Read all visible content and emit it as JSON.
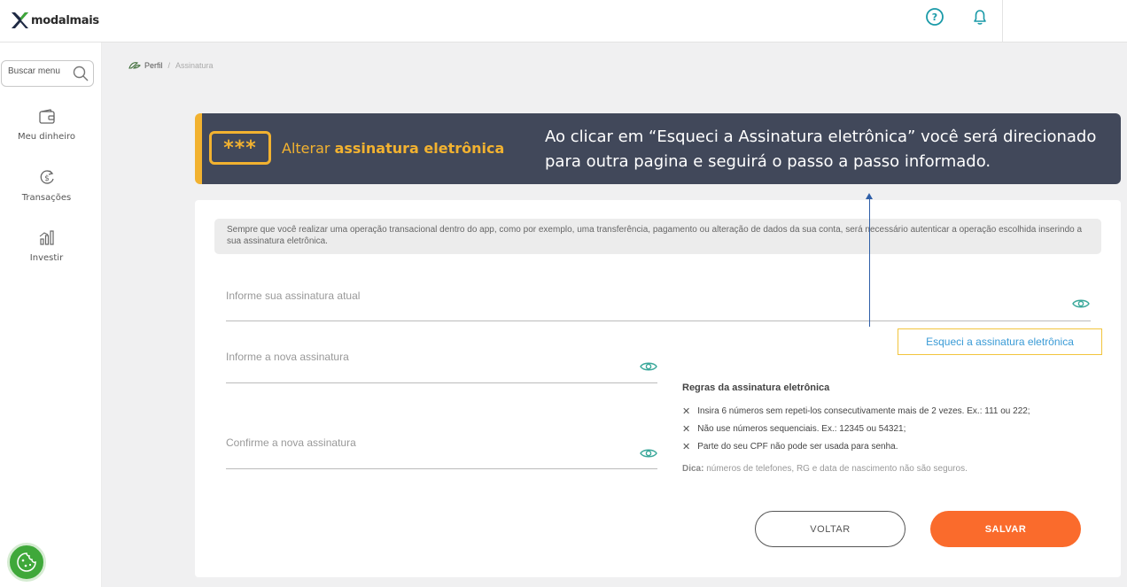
{
  "brand": {
    "name": "modalmais"
  },
  "topbar": {
    "help_icon": "help-circle-icon",
    "bell_icon": "bell-icon"
  },
  "sidebar": {
    "search_placeholder": "Buscar menu",
    "items": [
      {
        "label": "Meu dinheiro",
        "icon": "wallet-icon"
      },
      {
        "label": "Transações",
        "icon": "dollar-transfer-icon"
      },
      {
        "label": "Investir",
        "icon": "bar-chart-icon"
      }
    ]
  },
  "breadcrumb": {
    "root": "Perfil",
    "separator": "/",
    "current": "Assinatura"
  },
  "header": {
    "stars": "***",
    "title_prefix": "Alterar ",
    "title_bold": "assinatura eletrônica",
    "callout": "Ao clicar em “Esqueci a Assinatura eletrônica” você será direcionado para outra pagina e seguirá o passo a passo informado."
  },
  "info_text": "Sempre que você realizar uma operação transacional dentro do app, como por exemplo, uma transferência, pagamento ou alteração de dados da sua conta, será necessário autenticar a operação escolhida inserindo a sua assinatura eletrônica.",
  "form": {
    "current_placeholder": "Informe sua assinatura atual",
    "new_placeholder": "Informe a nova assinatura",
    "confirm_placeholder": "Confirme a nova assinatura",
    "forgot_link": "Esqueci a assinatura eletrônica"
  },
  "rules": {
    "title": "Regras da assinatura eletrônica",
    "items": [
      "Insira 6 números sem repeti-los consecutivamente mais de 2 vezes. Ex.: 111 ou 222;",
      "Não use números sequenciais. Ex.: 12345 ou 54321;",
      "Parte do seu CPF não pode ser usada para senha."
    ],
    "tip_label": "Dica:",
    "tip_text": " números de telefones, RG e data de nascimento não são seguros."
  },
  "buttons": {
    "back": "VOLTAR",
    "save": "SALVAR"
  },
  "colors": {
    "accent_orange": "#fa6b2c",
    "gold": "#f2b230",
    "brand_green": "#3fa83a",
    "link_blue": "#3a9bd6",
    "header_bg": "#41485a"
  }
}
